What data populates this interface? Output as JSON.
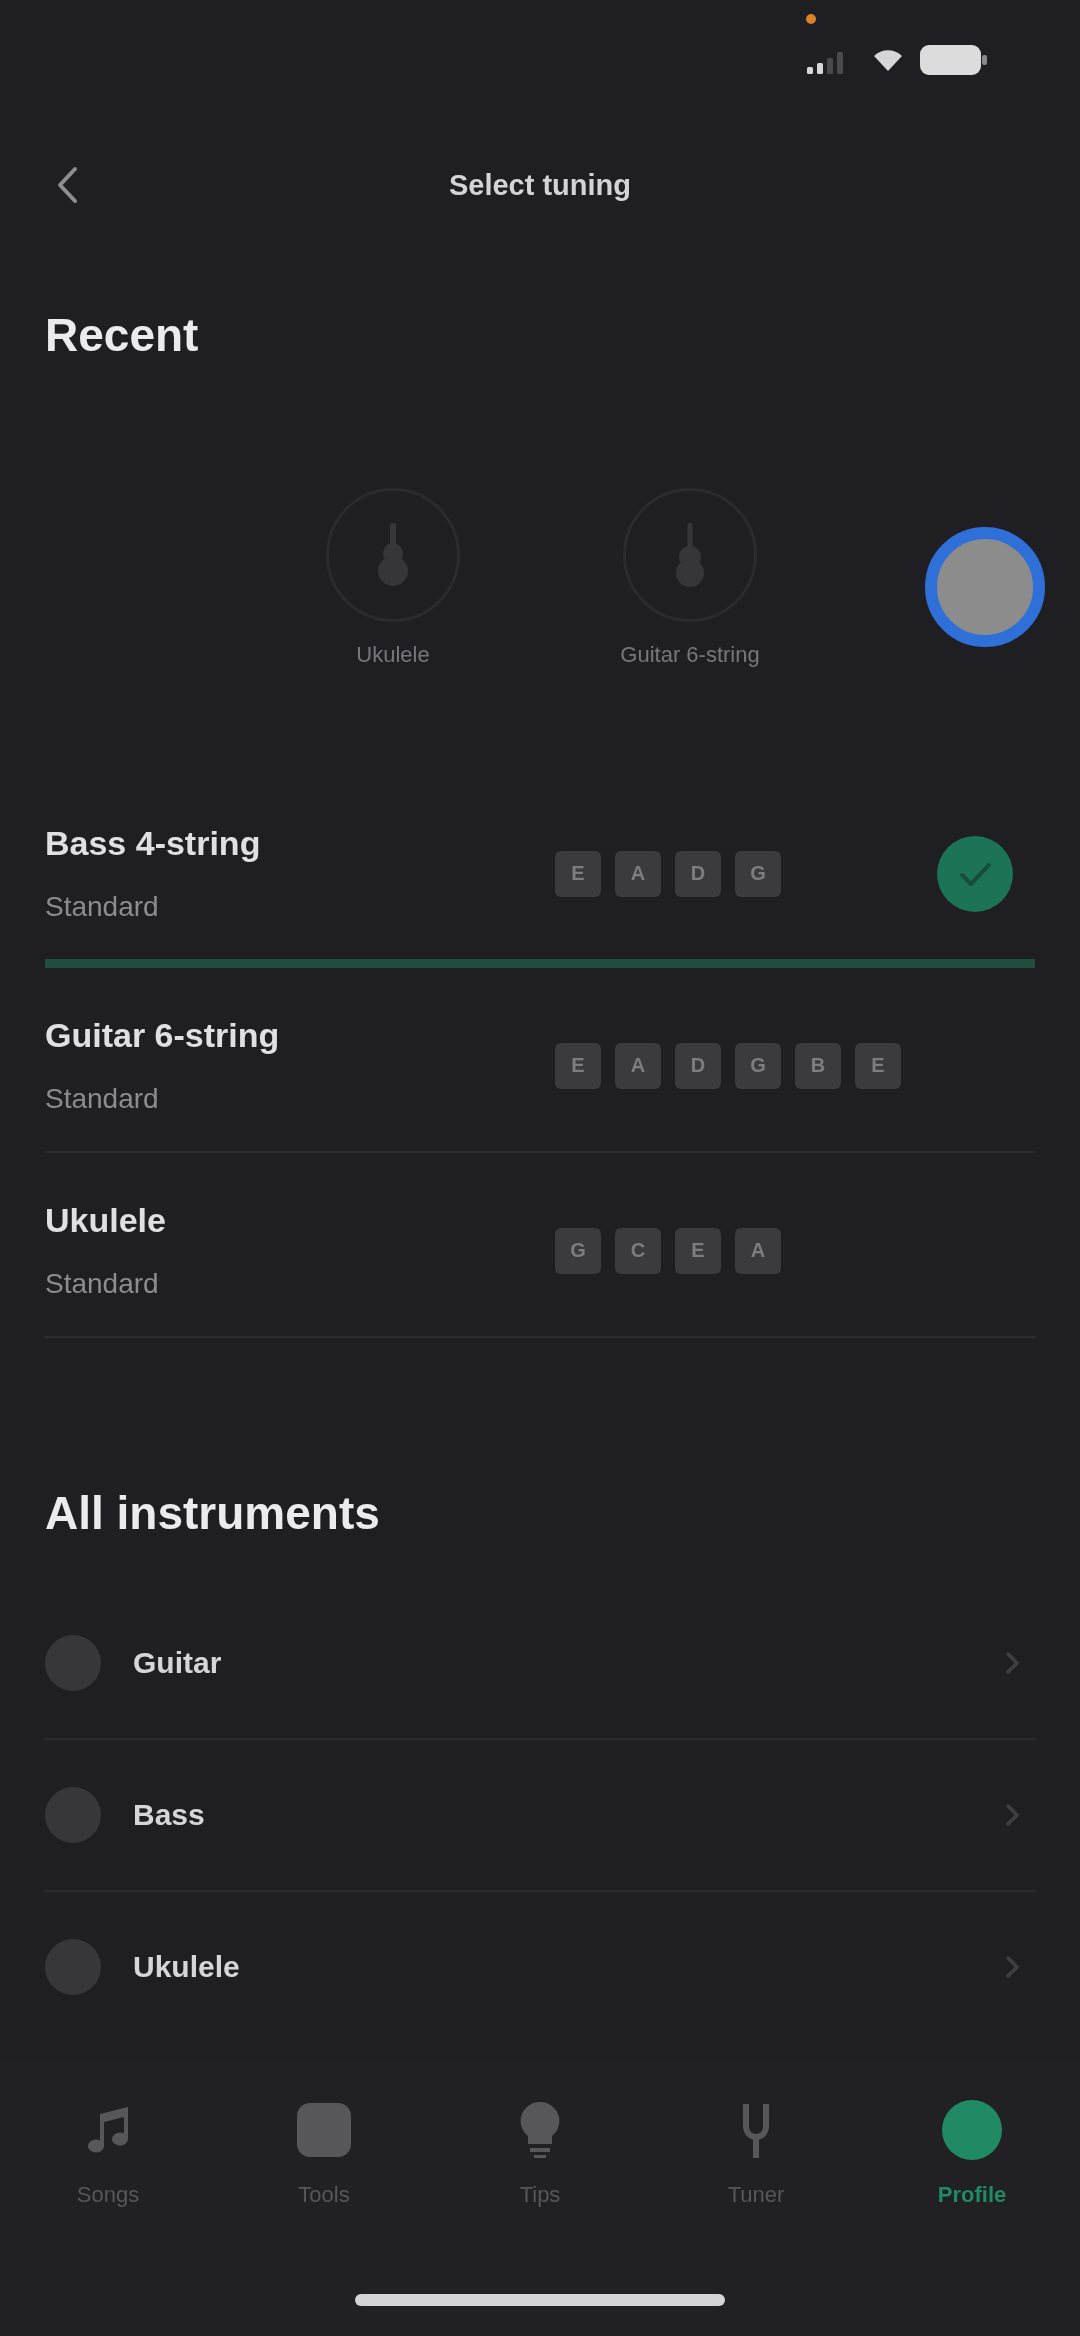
{
  "header": {
    "title": "Select tuning"
  },
  "recent": {
    "heading": "Recent",
    "items": [
      {
        "label": "Ukulele",
        "kind": "ukulele"
      },
      {
        "label": "Guitar 6-string",
        "kind": "guitar"
      }
    ]
  },
  "tunings": [
    {
      "instrument": "Bass 4-string",
      "tuning": "Standard",
      "notes": [
        "E",
        "A",
        "D",
        "G"
      ],
      "selected": true
    },
    {
      "instrument": "Guitar 6-string",
      "tuning": "Standard",
      "notes": [
        "E",
        "A",
        "D",
        "G",
        "B",
        "E"
      ],
      "selected": false
    },
    {
      "instrument": "Ukulele",
      "tuning": "Standard",
      "notes": [
        "G",
        "C",
        "E",
        "A"
      ],
      "selected": false
    }
  ],
  "all_instruments": {
    "heading": "All instruments",
    "items": [
      {
        "label": "Guitar"
      },
      {
        "label": "Bass"
      },
      {
        "label": "Ukulele"
      }
    ]
  },
  "tab_bar": [
    {
      "label": "Songs",
      "kind": "songs",
      "selected": false
    },
    {
      "label": "Tools",
      "kind": "tools",
      "selected": false
    },
    {
      "label": "Tips",
      "kind": "tips",
      "selected": false
    },
    {
      "label": "Tuner",
      "kind": "tuner",
      "selected": false
    },
    {
      "label": "Profile",
      "kind": "profile",
      "selected": true
    }
  ]
}
